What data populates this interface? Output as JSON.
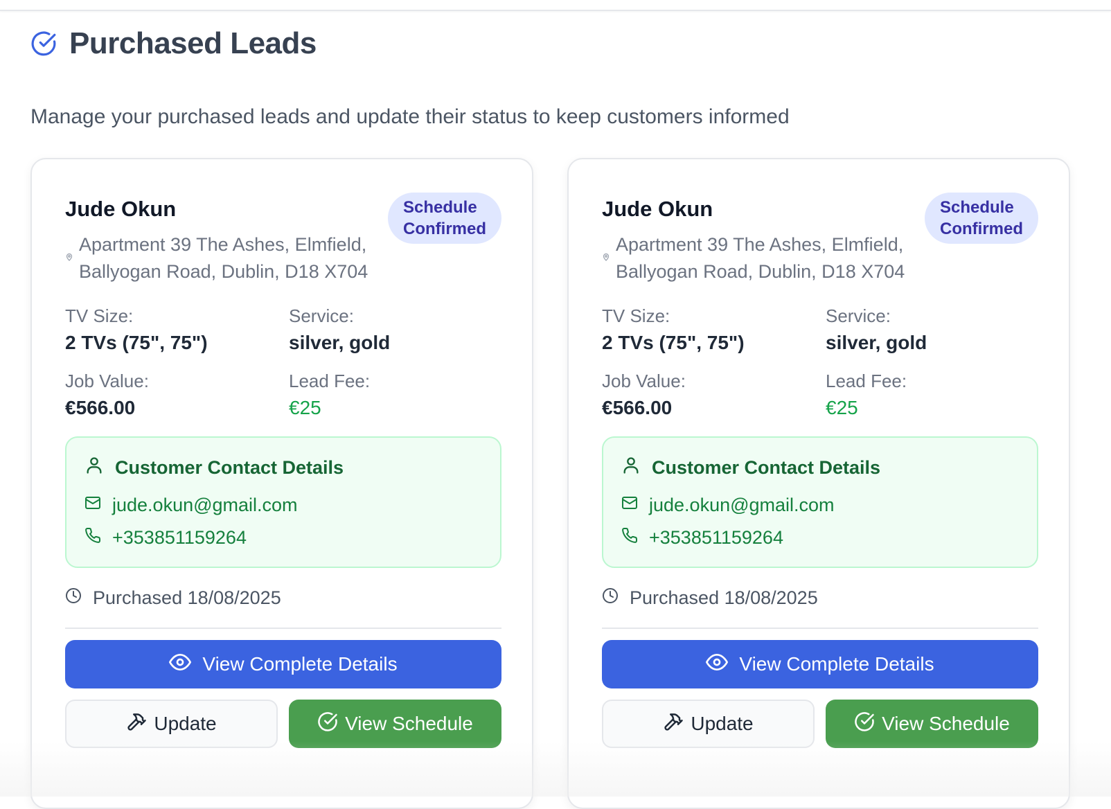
{
  "header": {
    "title": "Purchased Leads",
    "subtitle": "Manage your purchased leads and update their status to keep customers informed"
  },
  "colors": {
    "primary": "#3b63e0",
    "success": "#4a9e4f",
    "badge_bg": "#e0e7ff",
    "badge_text": "#3730a3",
    "contact_bg": "#f0fdf4",
    "lead_fee": "#16a34a"
  },
  "labels": {
    "tv_size": "TV Size:",
    "service": "Service:",
    "job_value": "Job Value:",
    "lead_fee": "Lead Fee:",
    "contact_title": "Customer Contact Details",
    "view_details": "View Complete Details",
    "update": "Update",
    "view_schedule": "View Schedule"
  },
  "leads": [
    {
      "name": "Jude Okun",
      "status_line1": "Schedule",
      "status_line2": "Confirmed",
      "address_line1": "Apartment 39 The Ashes, Elmfield,",
      "address_line2": "Ballyogan Road, Dublin, D18 X704",
      "tv_size": "2 TVs (75\", 75\")",
      "service": "silver, gold",
      "job_value": "€566.00",
      "lead_fee": "€25",
      "email": "jude.okun@gmail.com",
      "phone": "+353851159264",
      "purchased": "Purchased 18/08/2025"
    },
    {
      "name": "Jude Okun",
      "status_line1": "Schedule",
      "status_line2": "Confirmed",
      "address_line1": "Apartment 39 The Ashes, Elmfield,",
      "address_line2": "Ballyogan Road, Dublin, D18 X704",
      "tv_size": "2 TVs (75\", 75\")",
      "service": "silver, gold",
      "job_value": "€566.00",
      "lead_fee": "€25",
      "email": "jude.okun@gmail.com",
      "phone": "+353851159264",
      "purchased": "Purchased 18/08/2025"
    }
  ]
}
